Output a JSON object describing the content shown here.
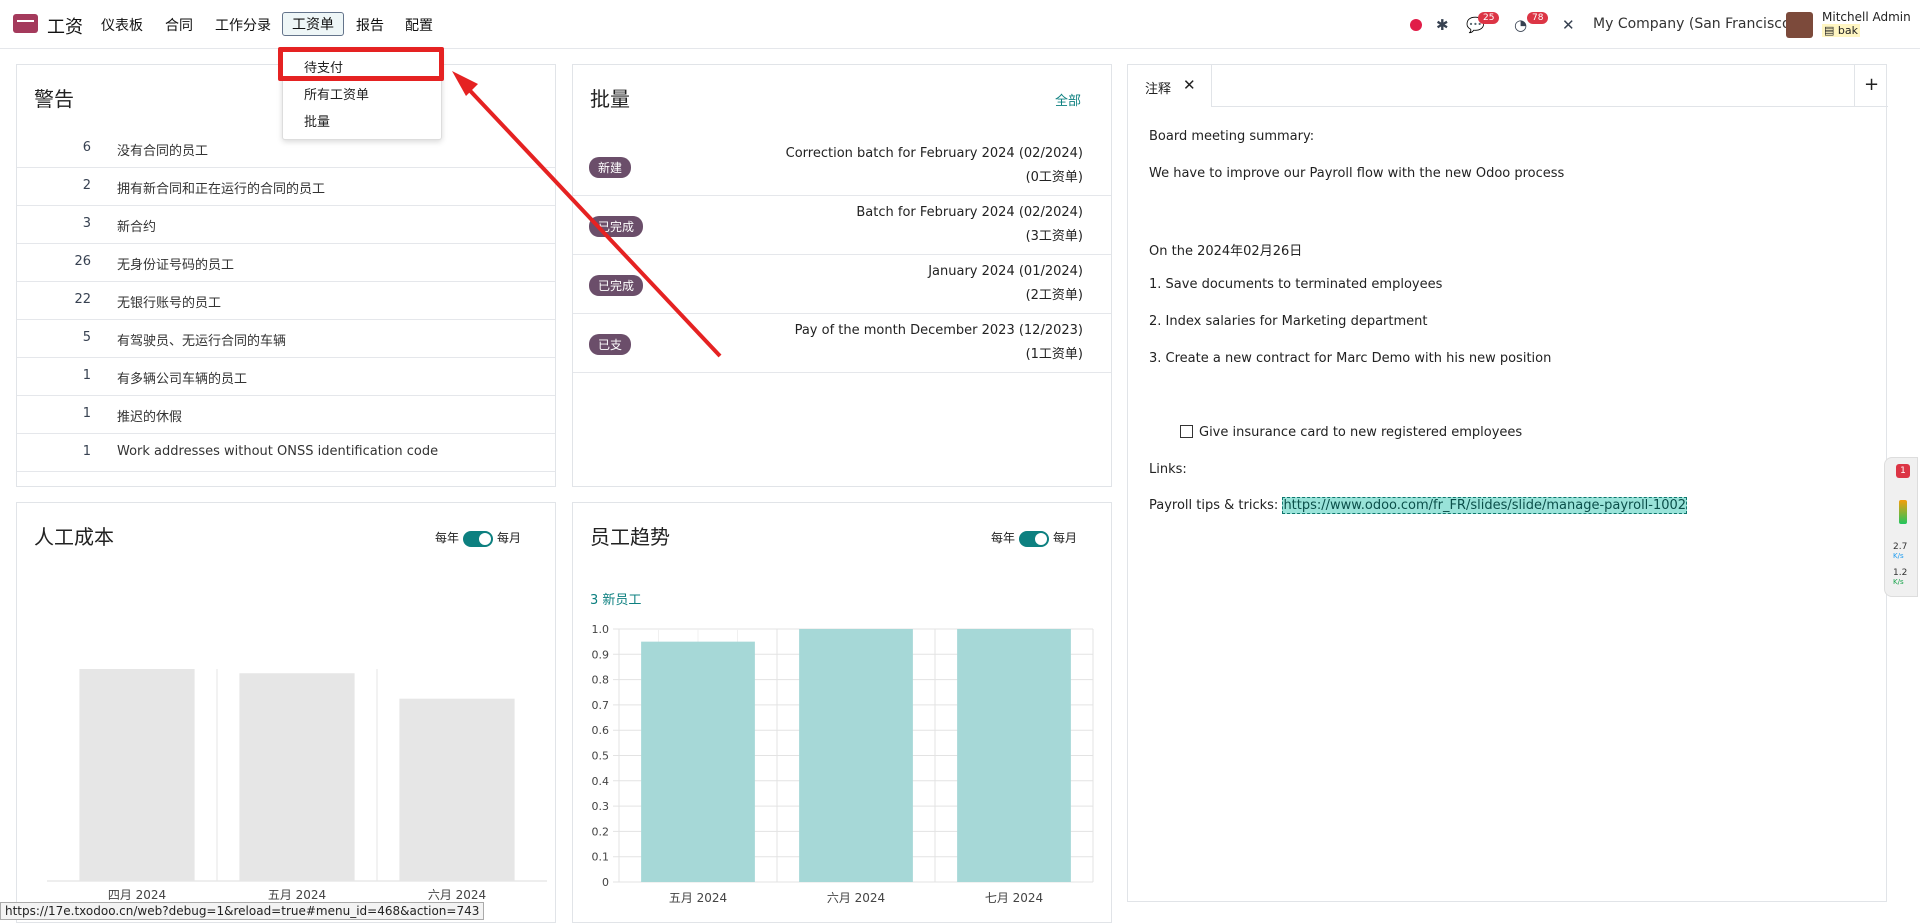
{
  "nav": {
    "app_name": "工资",
    "menu": [
      "仪表板",
      "合同",
      "工作分录",
      "工资单",
      "报告",
      "配置"
    ],
    "active_menu": "工资单",
    "chat_count": "25",
    "activity_count": "78",
    "company": "My Company (San Francisco)",
    "user_name": "Mitchell Admin",
    "db": "bak"
  },
  "dropdown": {
    "items": [
      "待支付",
      "所有工资单",
      "批量"
    ],
    "highlighted": "待支付"
  },
  "warnings": {
    "title": "警告",
    "rows": [
      {
        "count": "6",
        "label": "没有合同的员工"
      },
      {
        "count": "2",
        "label": "拥有新合同和正在运行的合同的员工"
      },
      {
        "count": "3",
        "label": "新合约"
      },
      {
        "count": "26",
        "label": "无身份证号码的员工"
      },
      {
        "count": "22",
        "label": "无银行账号的员工"
      },
      {
        "count": "5",
        "label": "有驾驶员、无运行合同的车辆"
      },
      {
        "count": "1",
        "label": "有多辆公司车辆的员工"
      },
      {
        "count": "1",
        "label": "推迟的休假"
      },
      {
        "count": "1",
        "label": "Work addresses without ONSS identification code"
      }
    ]
  },
  "batches": {
    "title": "批量",
    "all_link": "全部",
    "rows": [
      {
        "tag": "新建",
        "name": "Correction batch for February 2024 (02/2024)",
        "count": "(0工资单)"
      },
      {
        "tag": "已完成",
        "name": "Batch for February 2024 (02/2024)",
        "count": "(3工资单)"
      },
      {
        "tag": "已完成",
        "name": "January 2024 (01/2024)",
        "count": "(2工资单)"
      },
      {
        "tag": "已支",
        "name": "Pay of the month December 2023 (12/2023)",
        "count": "(1工资单)"
      }
    ]
  },
  "labor_cost": {
    "title": "人工成本",
    "toggle_left": "每年",
    "toggle_right": "每月"
  },
  "emp_trend": {
    "title": "员工趋势",
    "toggle_left": "每年",
    "toggle_right": "每月",
    "new_employees": "3 新员工"
  },
  "notes": {
    "tab": "注释",
    "lines": [
      "Board meeting summary:",
      "We have to improve our Payroll flow with the new Odoo process",
      "On the 2024年02月26日",
      "1. Save documents to terminated employees",
      "2. Index salaries for Marketing department",
      "3. Create a new contract for Marc Demo with his new position"
    ],
    "checkbox": "Give insurance card to new registered employees",
    "links_label": "Links:",
    "tips_label": "Payroll tips & tricks: ",
    "tips_url": "https://www.odoo.com/fr_FR/slides/slide/manage-payroll-1002"
  },
  "side_widget": {
    "badge": "1",
    "speed1": "2.7",
    "speed2": "1.2",
    "unit": "K/s"
  },
  "status_url": "https://17e.txodoo.cn/web?debug=1&reload=true#menu_id=468&action=743",
  "chart_data": [
    {
      "type": "bar",
      "title": "人工成本",
      "categories": [
        "四月 2024",
        "五月 2024",
        "六月 2024"
      ],
      "values": [
        1.0,
        0.98,
        0.86
      ],
      "note": "placeholder bars (gray, no axis)"
    },
    {
      "type": "bar",
      "title": "员工趋势",
      "categories": [
        "五月 2024",
        "六月 2024",
        "七月 2024"
      ],
      "values": [
        0.95,
        1.0,
        1.0
      ],
      "ylim": [
        0,
        1.0
      ],
      "yticks": [
        "0",
        "0.1",
        "0.2",
        "0.3",
        "0.4",
        "0.5",
        "0.6",
        "0.7",
        "0.8",
        "0.9",
        "1.0"
      ],
      "color": "#a6d8d7"
    }
  ]
}
